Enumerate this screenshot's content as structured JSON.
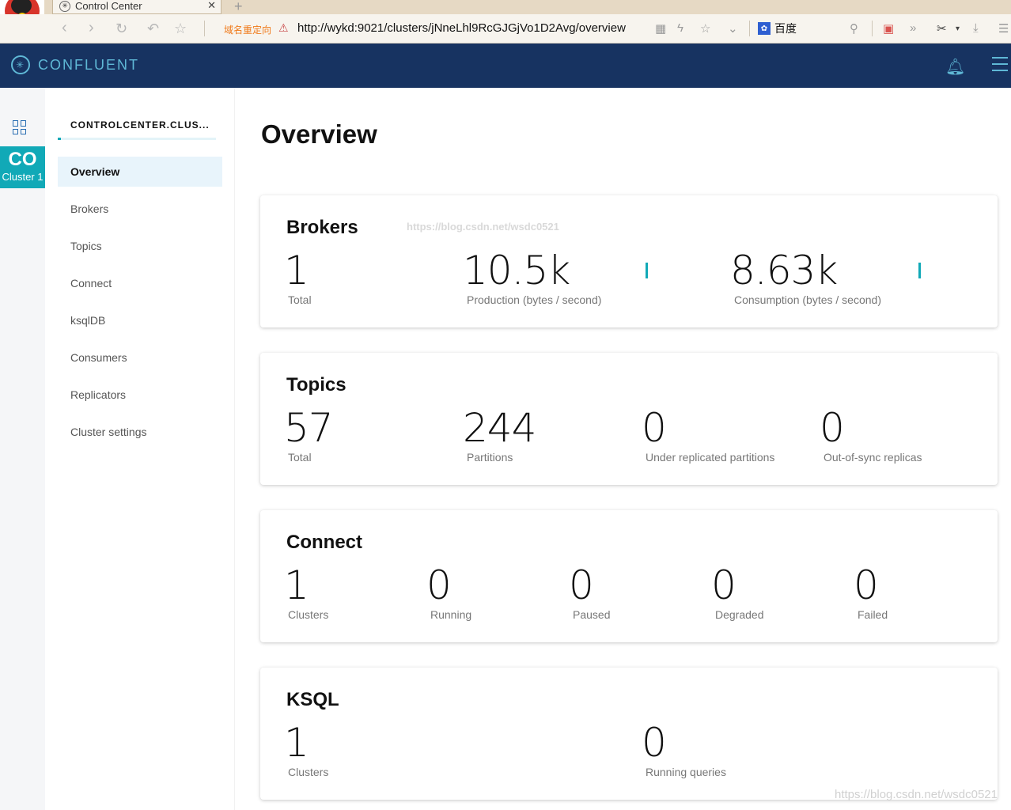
{
  "browser": {
    "tab_title": "Control Center",
    "redirect_label": "域名重定向",
    "url": "http://wykd:9021/clusters/jNneLhl9RcGJGjVo1D2Avg/overview",
    "search_engine": "百度"
  },
  "header": {
    "brand": "CONFLUENT",
    "accent_color": "#5fb8d6",
    "background": "#173361"
  },
  "rail": {
    "cluster_abbrev": "CO",
    "cluster_label": "Cluster 1"
  },
  "sidebar": {
    "cluster_name": "CONTROLCENTER.CLUS...",
    "items": [
      {
        "label": "Overview",
        "active": true
      },
      {
        "label": "Brokers"
      },
      {
        "label": "Topics"
      },
      {
        "label": "Connect"
      },
      {
        "label": "ksqlDB"
      },
      {
        "label": "Consumers"
      },
      {
        "label": "Replicators"
      },
      {
        "label": "Cluster settings"
      }
    ]
  },
  "main": {
    "title": "Overview",
    "cards": {
      "brokers": {
        "title": "Brokers",
        "watermark": "https://blog.csdn.net/wsdc0521",
        "stats": [
          {
            "value": "1",
            "label": "Total"
          },
          {
            "value": "10.5k",
            "label": "Production (bytes / second)"
          },
          {
            "value": "8.63k",
            "label": "Consumption (bytes / second)"
          }
        ]
      },
      "topics": {
        "title": "Topics",
        "stats": [
          {
            "value": "57",
            "label": "Total"
          },
          {
            "value": "244",
            "label": "Partitions"
          },
          {
            "value": "0",
            "label": "Under replicated partitions"
          },
          {
            "value": "0",
            "label": "Out-of-sync replicas"
          }
        ]
      },
      "connect": {
        "title": "Connect",
        "stats": [
          {
            "value": "1",
            "label": "Clusters"
          },
          {
            "value": "0",
            "label": "Running"
          },
          {
            "value": "0",
            "label": "Paused"
          },
          {
            "value": "0",
            "label": "Degraded"
          },
          {
            "value": "0",
            "label": "Failed"
          }
        ]
      },
      "ksql": {
        "title": "KSQL",
        "stats": [
          {
            "value": "1",
            "label": "Clusters"
          },
          {
            "value": "0",
            "label": "Running queries"
          }
        ]
      }
    }
  },
  "page_watermark": "https://blog.csdn.net/wsdc0521"
}
